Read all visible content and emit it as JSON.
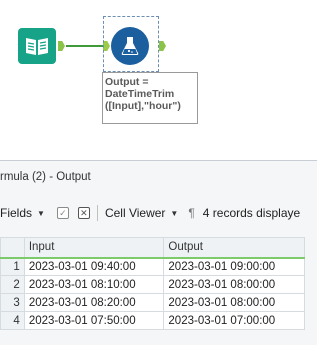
{
  "workflow": {
    "annotation": "Output =\nDateTimeTrim\n([Input],\"hour\")"
  },
  "results": {
    "title": "rmula (2) - Output",
    "toolbar": {
      "fields_label": "Fields",
      "cell_viewer_label": "Cell Viewer",
      "records_label": "4 records displaye"
    },
    "columns": [
      "Input",
      "Output"
    ],
    "rows": [
      {
        "n": "1",
        "input": "2023-03-01 09:40:00",
        "output": "2023-03-01 09:00:00"
      },
      {
        "n": "2",
        "input": "2023-03-01 08:10:00",
        "output": "2023-03-01 08:00:00"
      },
      {
        "n": "3",
        "input": "2023-03-01 08:20:00",
        "output": "2023-03-01 08:00:00"
      },
      {
        "n": "4",
        "input": "2023-03-01 07:50:00",
        "output": "2023-03-01 07:00:00"
      }
    ]
  },
  "colors": {
    "input_tool": "#16a387",
    "formula_tool": "#1b5f9e",
    "connector": "#3f9b3a",
    "header_accent": "#7ccb6a"
  },
  "icons": {
    "input_tool": "book-icon",
    "formula_tool": "flask-icon"
  }
}
